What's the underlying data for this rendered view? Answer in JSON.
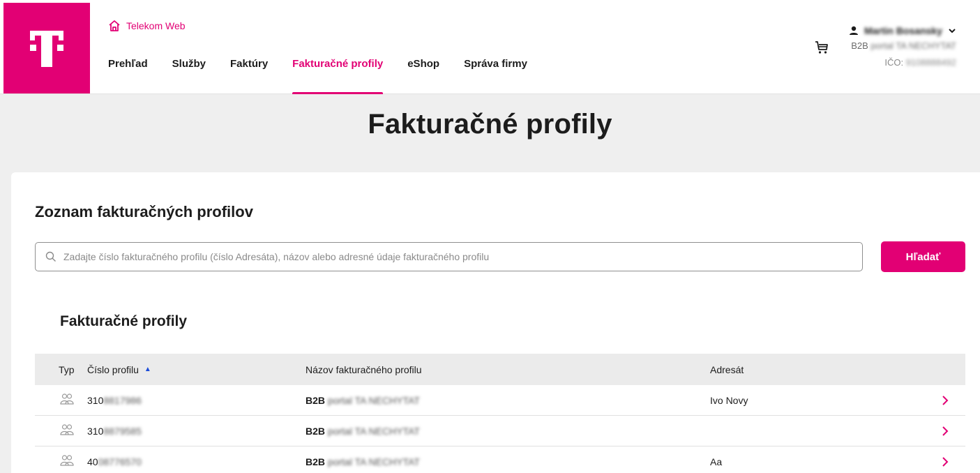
{
  "header": {
    "logo": "T",
    "home_link": "Telekom Web",
    "nav": [
      {
        "label": "Prehľad",
        "active": false
      },
      {
        "label": "Služby",
        "active": false
      },
      {
        "label": "Faktúry",
        "active": false
      },
      {
        "label": "Fakturačné profily",
        "active": true
      },
      {
        "label": "eShop",
        "active": false
      },
      {
        "label": "Správa firmy",
        "active": false
      }
    ],
    "user": {
      "name": "Martin Bosansky",
      "company_prefix": "B2B",
      "company_rest": "portal TA NECHYTAT",
      "ico_label": "IČO:",
      "ico_value": "9108888492"
    }
  },
  "page_title": "Fakturačné profily",
  "section_title": "Zoznam fakturačných profilov",
  "search": {
    "placeholder": "Zadajte číslo fakturačného profilu (číslo Adresáta), názov alebo adresné údaje fakturačného profilu",
    "value": "",
    "button_label": "Hľadať"
  },
  "table_title": "Fakturačné profily",
  "table": {
    "columns": {
      "typ": "Typ",
      "number": "Číslo profilu",
      "name": "Názov fakturačného profilu",
      "addressee": "Adresát"
    },
    "sort_indicator": "▲",
    "rows": [
      {
        "number_visible": "310",
        "number_blurred": "8817986",
        "name_prefix": "B2B",
        "name_blurred": "portal TA NECHYTAT",
        "addressee": "Ivo Novy"
      },
      {
        "number_visible": "310",
        "number_blurred": "8879585",
        "name_prefix": "B2B",
        "name_blurred": "portal TA NECHYTAT",
        "addressee": ""
      },
      {
        "number_visible": "40",
        "number_blurred": "08776570",
        "name_prefix": "B2B",
        "name_blurred": "portal TA NECHYTAT",
        "addressee": "Aa"
      }
    ]
  },
  "colors": {
    "brand": "#e20074",
    "background": "#efefef",
    "table_header": "#ebebeb"
  },
  "icons": [
    "home-icon",
    "cart-icon",
    "user-icon",
    "chevron-down-icon",
    "search-icon",
    "people-icon",
    "chevron-right-icon",
    "sort-up-icon"
  ]
}
